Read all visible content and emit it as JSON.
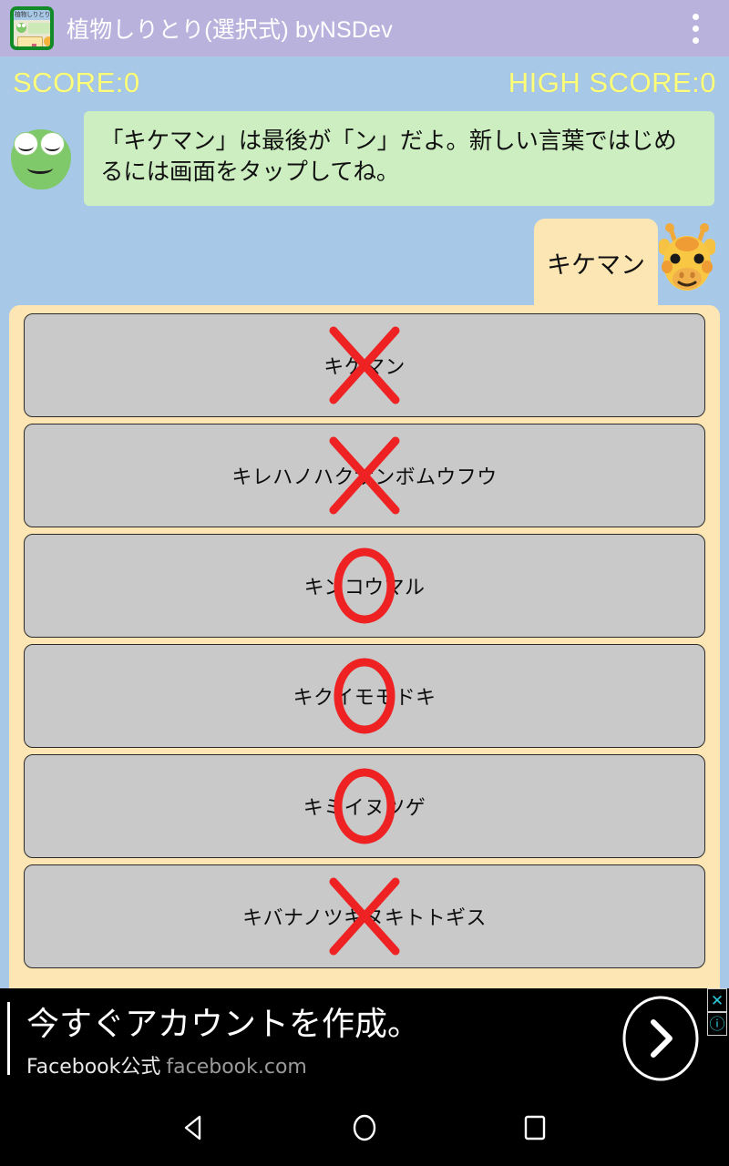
{
  "titlebar": {
    "app_icon_name": "app-icon",
    "icon_caption": "植物しりとり",
    "title": "植物しりとり(選択式) byNSDev",
    "overflow_label": "more-options",
    "bg_color": "#b9b2dd"
  },
  "game": {
    "bg_color": "#a8c8e8",
    "score_label": "SCORE:0",
    "high_score_label": "HIGH SCORE:0",
    "score_color": "#ffff7a",
    "speech": {
      "character": "frog",
      "message": "「キケマン」は最後が「ン」だよ。新しい言葉ではじめるには画面をタップしてね。",
      "bubble_color": "#cdeec0"
    },
    "current_word_tab": {
      "word": "キケマン",
      "tab_color": "#fbe6b4",
      "character": "giraffe"
    },
    "choices_panel_color": "#fde6b4",
    "mark_color": "#ee2222",
    "choices": [
      {
        "label": "キケマン",
        "mark": "cross"
      },
      {
        "label": "キレハノハクサンボムウフウ",
        "mark": "cross"
      },
      {
        "label": "キンコウマル",
        "mark": "circle"
      },
      {
        "label": "キクイモモドキ",
        "mark": "circle"
      },
      {
        "label": "キミイヌツゲ",
        "mark": "circle"
      },
      {
        "label": "キバナノツキヌキトトギス",
        "mark": "cross"
      }
    ]
  },
  "ad": {
    "headline": "今すぐアカウントを作成。",
    "brand": "Facebook公式",
    "url": "facebook.com",
    "cta_icon": "chevron-right-icon",
    "close_label": "✕",
    "info_label": "ⓘ",
    "badge_color": "#2ec8d8"
  },
  "navbar": {
    "back_label": "back",
    "home_label": "home",
    "recents_label": "recents"
  }
}
